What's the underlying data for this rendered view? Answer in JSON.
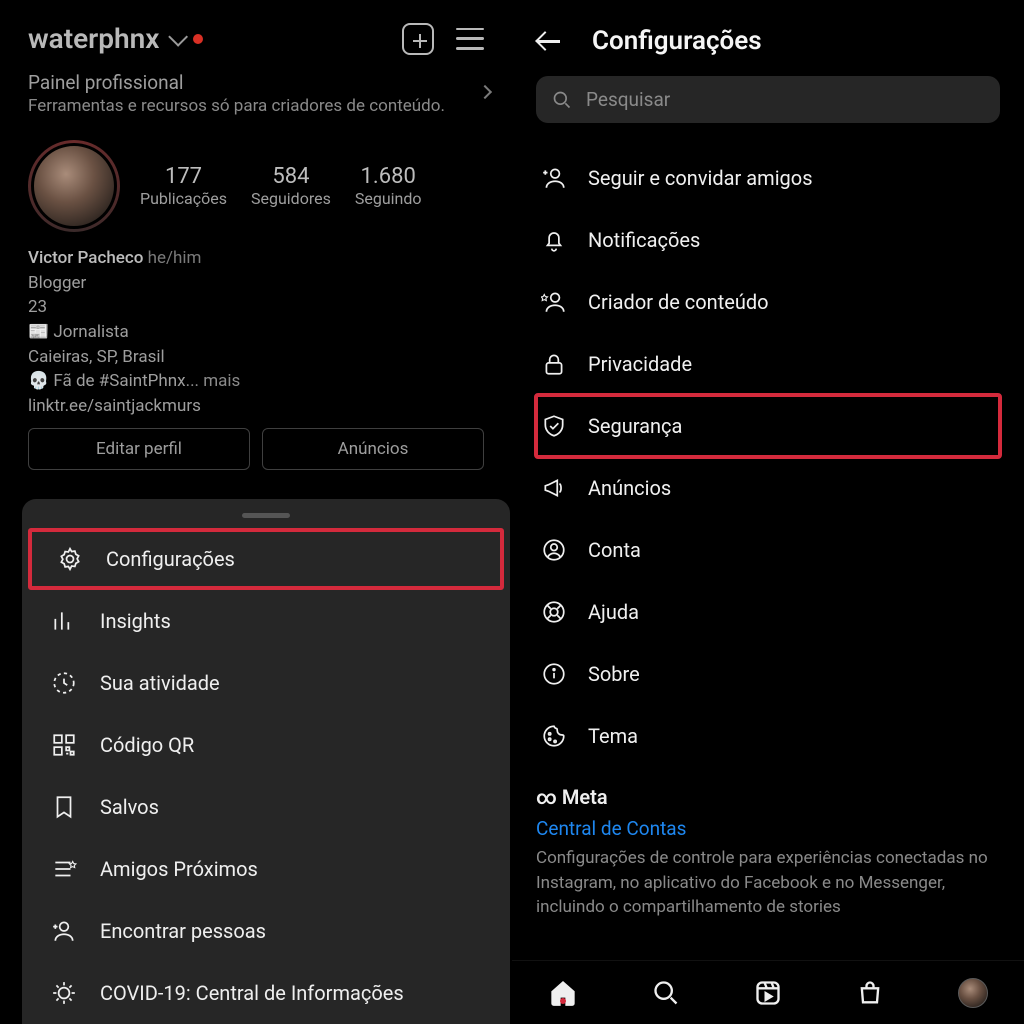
{
  "colors": {
    "highlight": "#d42a3c",
    "link": "#1e87f0"
  },
  "left": {
    "username": "waterphnx",
    "professional_panel": {
      "title": "Painel profissional",
      "subtitle": "Ferramentas e recursos só para criadores de conteúdo."
    },
    "stats": {
      "posts": {
        "value": "177",
        "label": "Publicações"
      },
      "followers": {
        "value": "584",
        "label": "Seguidores"
      },
      "following": {
        "value": "1.680",
        "label": "Seguindo"
      }
    },
    "bio": {
      "name": "Victor Pacheco",
      "pronouns": "he/him",
      "category": "Blogger",
      "line1": "23",
      "line2": "📰 Jornalista",
      "line3": "Caieiras, SP, Brasil",
      "line4_prefix": "💀 Fã de #SaintPhnx",
      "more": "... mais",
      "link": "linktr.ee/saintjackmurs"
    },
    "buttons": {
      "edit": "Editar perfil",
      "ads": "Anúncios"
    },
    "sheet": [
      {
        "label": "Configurações",
        "icon": "gear-icon",
        "highlighted": true
      },
      {
        "label": "Insights",
        "icon": "insights-icon",
        "highlighted": false
      },
      {
        "label": "Sua atividade",
        "icon": "activity-icon",
        "highlighted": false
      },
      {
        "label": "Código QR",
        "icon": "qr-icon",
        "highlighted": false
      },
      {
        "label": "Salvos",
        "icon": "bookmark-icon",
        "highlighted": false
      },
      {
        "label": "Amigos Próximos",
        "icon": "close-friends-icon",
        "highlighted": false
      },
      {
        "label": "Encontrar pessoas",
        "icon": "add-person-icon",
        "highlighted": false
      },
      {
        "label": "COVID-19: Central de Informações",
        "icon": "covid-icon",
        "highlighted": false
      }
    ]
  },
  "right": {
    "title": "Configurações",
    "search_placeholder": "Pesquisar",
    "items": [
      {
        "label": "Seguir e convidar amigos",
        "icon": "add-person-icon",
        "highlighted": false
      },
      {
        "label": "Notificações",
        "icon": "bell-icon",
        "highlighted": false
      },
      {
        "label": "Criador de conteúdo",
        "icon": "creator-icon",
        "highlighted": false
      },
      {
        "label": "Privacidade",
        "icon": "lock-icon",
        "highlighted": false
      },
      {
        "label": "Segurança",
        "icon": "shield-icon",
        "highlighted": true
      },
      {
        "label": "Anúncios",
        "icon": "megaphone-icon",
        "highlighted": false
      },
      {
        "label": "Conta",
        "icon": "account-icon",
        "highlighted": false
      },
      {
        "label": "Ajuda",
        "icon": "help-icon",
        "highlighted": false
      },
      {
        "label": "Sobre",
        "icon": "info-icon",
        "highlighted": false
      },
      {
        "label": "Tema",
        "icon": "theme-icon",
        "highlighted": false
      }
    ],
    "meta": {
      "brand": "∞ Meta",
      "link": "Central de Contas",
      "description": "Configurações de controle para experiências conectadas no Instagram, no aplicativo do Facebook e no Messenger, incluindo o compartilhamento de stories"
    }
  }
}
